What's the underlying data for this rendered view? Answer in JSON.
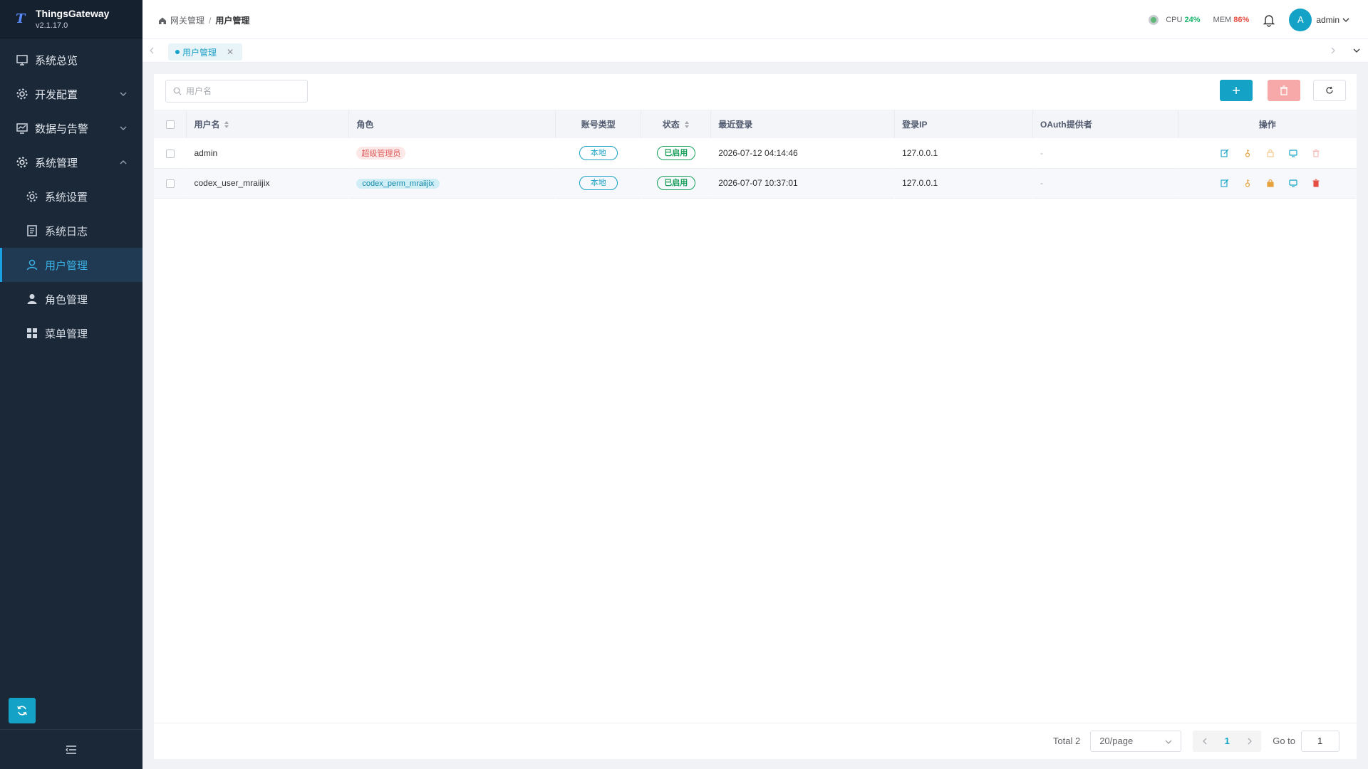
{
  "app": {
    "name": "ThingsGateway",
    "version": "v2.1.17.0"
  },
  "sidebar": {
    "items": [
      {
        "label": "系统总览",
        "icon": "monitor-icon",
        "level": 1,
        "expandable": false
      },
      {
        "label": "开发配置",
        "icon": "gear-icon",
        "level": 1,
        "expandable": true,
        "expanded": false
      },
      {
        "label": "数据与告警",
        "icon": "chart-monitor-icon",
        "level": 1,
        "expandable": true,
        "expanded": false
      },
      {
        "label": "系统管理",
        "icon": "settings-icon",
        "level": 1,
        "expandable": true,
        "expanded": true
      },
      {
        "label": "系统设置",
        "icon": "settings-icon",
        "level": 2
      },
      {
        "label": "系统日志",
        "icon": "document-icon",
        "level": 2
      },
      {
        "label": "用户管理",
        "icon": "user-icon",
        "level": 2,
        "active": true
      },
      {
        "label": "角色管理",
        "icon": "person-filled-icon",
        "level": 2
      },
      {
        "label": "菜单管理",
        "icon": "grid-icon",
        "level": 2
      }
    ]
  },
  "header": {
    "breadcrumb": [
      "网关管理",
      "用户管理"
    ],
    "cpu_label": "CPU",
    "cpu_value": "24%",
    "mem_label": "MEM",
    "mem_value": "86%",
    "avatar_letter": "A",
    "user": "admin"
  },
  "tabs": [
    {
      "label": "用户管理",
      "active": true
    }
  ],
  "search": {
    "placeholder": "用户名",
    "value": ""
  },
  "table": {
    "columns": {
      "username": "用户名",
      "role": "角色",
      "account_type": "账号类型",
      "status": "状态",
      "last_login": "最近登录",
      "login_ip": "登录IP",
      "oauth": "OAuth提供者",
      "actions": "操作"
    },
    "rows": [
      {
        "username": "admin",
        "role": "超级管理员",
        "role_kind": "admin",
        "account_type": "本地",
        "status": "已启用",
        "last_login": "2026-07-12 04:14:46",
        "login_ip": "127.0.0.1",
        "oauth": "-",
        "delete_enabled": false
      },
      {
        "username": "codex_user_mraiijix",
        "role": "codex_perm_mraiijix",
        "role_kind": "perm",
        "account_type": "本地",
        "status": "已启用",
        "last_login": "2026-07-07 10:37:01",
        "login_ip": "127.0.0.1",
        "oauth": "-",
        "delete_enabled": true
      }
    ]
  },
  "pagination": {
    "total_text": "Total 2",
    "page_size": "20/page",
    "current_page": "1",
    "goto_label": "Go to",
    "goto_value": "1"
  },
  "colors": {
    "accent": "#14a3c7",
    "sidebar_bg": "#1b2838",
    "danger": "#e54d42",
    "success": "#19a05a"
  }
}
